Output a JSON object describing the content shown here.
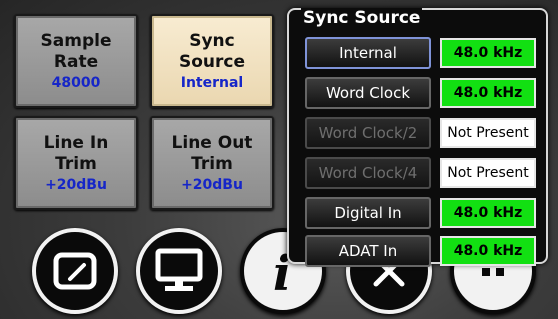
{
  "tiles": {
    "sample_rate": {
      "line1": "Sample",
      "line2": "Rate",
      "value": "48000"
    },
    "sync_source": {
      "line1": "Sync",
      "line2": "Source",
      "value": "Internal"
    },
    "line_in_trim": {
      "line1": "Line In",
      "line2": "Trim",
      "value": "+20dBu"
    },
    "line_out_trim": {
      "line1": "Line Out",
      "line2": "Trim",
      "value": "+20dBu"
    }
  },
  "dock": [
    {
      "icon": "meter-icon"
    },
    {
      "icon": "monitor-icon"
    },
    {
      "icon": "info-icon"
    },
    {
      "icon": "tools-icon"
    },
    {
      "icon": "more-icon"
    }
  ],
  "panel": {
    "title": "Sync Source",
    "sources": [
      {
        "label": "Internal",
        "rate": "48.0 kHz",
        "status": "present",
        "selected": true
      },
      {
        "label": "Word Clock",
        "rate": "48.0 kHz",
        "status": "present",
        "selected": false
      },
      {
        "label": "Word Clock/2",
        "rate": "Not Present",
        "status": "absent",
        "selected": false
      },
      {
        "label": "Word Clock/4",
        "rate": "Not Present",
        "status": "absent",
        "selected": false
      },
      {
        "label": "Digital In",
        "rate": "48.0 kHz",
        "status": "present",
        "selected": false
      },
      {
        "label": "ADAT In",
        "rate": "48.0 kHz",
        "status": "present",
        "selected": false
      }
    ]
  },
  "colors": {
    "present": "#12e012",
    "absent": "#ffffff",
    "value_text": "#1626c8",
    "active_tile": "#f3e6c6"
  }
}
